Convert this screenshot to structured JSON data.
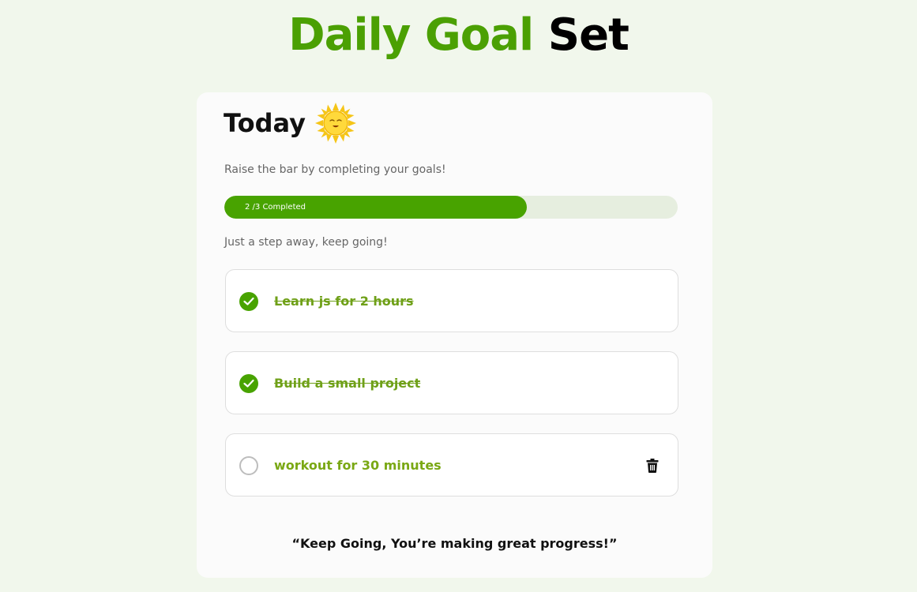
{
  "header": {
    "title_part1": "Daily Goal",
    "title_part2": "Set",
    "accent_color": "#4ba003"
  },
  "card": {
    "title": "Today",
    "title_icon": "sun-icon",
    "subtitle": "Raise the bar by completing your goals!",
    "progress": {
      "completed": 2,
      "total": 3,
      "fraction": 0.667,
      "label": "2 /3 Completed",
      "fill_color": "#48a300"
    },
    "encouragement": "Just a step away, keep going!",
    "goals": [
      {
        "label": "Learn js for 2 hours",
        "completed": true
      },
      {
        "label": "Build a small project",
        "completed": true
      },
      {
        "label": "workout for 30 minutes",
        "completed": false,
        "action_icon": "trash-icon"
      }
    ],
    "quote": "“Keep Going, You’re making great progress!”"
  }
}
